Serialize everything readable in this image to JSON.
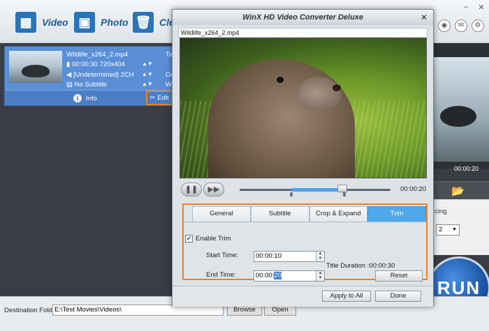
{
  "main": {
    "toolbar": {
      "video_label": "Video",
      "photo_label": "Photo",
      "clear_label": "Clea"
    },
    "file_item": {
      "name": "Wildlife_x264_2.mp4",
      "duration_res": "00:00:30  720x404",
      "audio": "[Undetermined] 2CH",
      "subtitle": "No Subtitle",
      "trunc_1": "Tar",
      "trunc_2": "Out",
      "trunc_3": "Wi",
      "info_label": "Info",
      "edit_label": "Edit"
    },
    "preview_time": "00:00:20",
    "settings_trunc": "cing",
    "settings_select": "2",
    "run_label": "RUN",
    "destination": {
      "label": "Destination Folder:",
      "value": "E:\\Test Movies\\Videos\\",
      "browse_label": "Browse",
      "open_label": "Open"
    }
  },
  "dialog": {
    "title": "WinX HD Video Converter Deluxe",
    "filename": "Wildlife_x264_2.mp4",
    "time": "00:00:20",
    "tabs": [
      "General",
      "Subtitle",
      "Crop & Expand",
      "Trim"
    ],
    "active_tab": "Trim",
    "trim": {
      "enable_label": "Enable Trim",
      "enabled": true,
      "start_label": "Start Time:",
      "start_value": "00:00:10",
      "end_label": "End Time:",
      "end_prefix": "00:00:",
      "end_selected": "20",
      "title_duration": "Title Duration :00:00:30",
      "reset_label": "Reset"
    },
    "apply_label": "Apply to All",
    "done_label": "Done"
  },
  "colors": {
    "accent": "#f08020",
    "tab_active": "#4ea9ec",
    "list_selected": "#5a8fd6"
  }
}
